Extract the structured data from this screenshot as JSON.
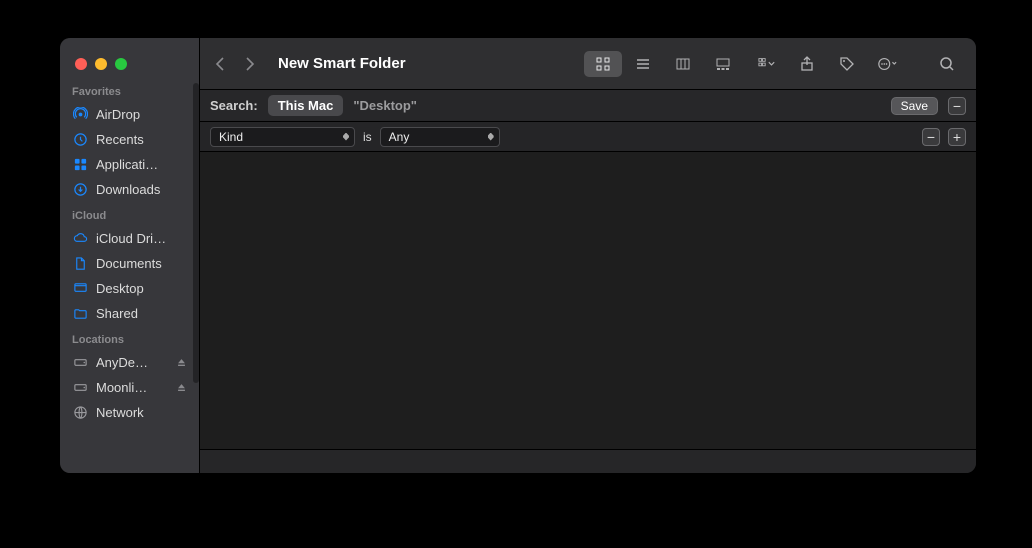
{
  "window": {
    "title": "New Smart Folder"
  },
  "sidebar": {
    "sections": [
      {
        "header": "Favorites",
        "items": [
          {
            "icon": "airdrop",
            "label": "AirDrop"
          },
          {
            "icon": "clock",
            "label": "Recents"
          },
          {
            "icon": "apps",
            "label": "Applicati…"
          },
          {
            "icon": "download",
            "label": "Downloads"
          }
        ]
      },
      {
        "header": "iCloud",
        "items": [
          {
            "icon": "cloud",
            "label": "iCloud Dri…"
          },
          {
            "icon": "doc",
            "label": "Documents"
          },
          {
            "icon": "desktop",
            "label": "Desktop"
          },
          {
            "icon": "folder",
            "label": "Shared"
          }
        ]
      },
      {
        "header": "Locations",
        "items": [
          {
            "icon": "disk",
            "label": "AnyDe…",
            "eject": true
          },
          {
            "icon": "disk",
            "label": "Moonli…",
            "eject": true
          },
          {
            "icon": "globe",
            "label": "Network"
          }
        ]
      }
    ]
  },
  "search": {
    "label": "Search:",
    "scope_active": "This Mac",
    "scope_other": "\"Desktop\"",
    "save": "Save"
  },
  "criteria": {
    "attribute": "Kind",
    "operator": "is",
    "value": "Any"
  }
}
